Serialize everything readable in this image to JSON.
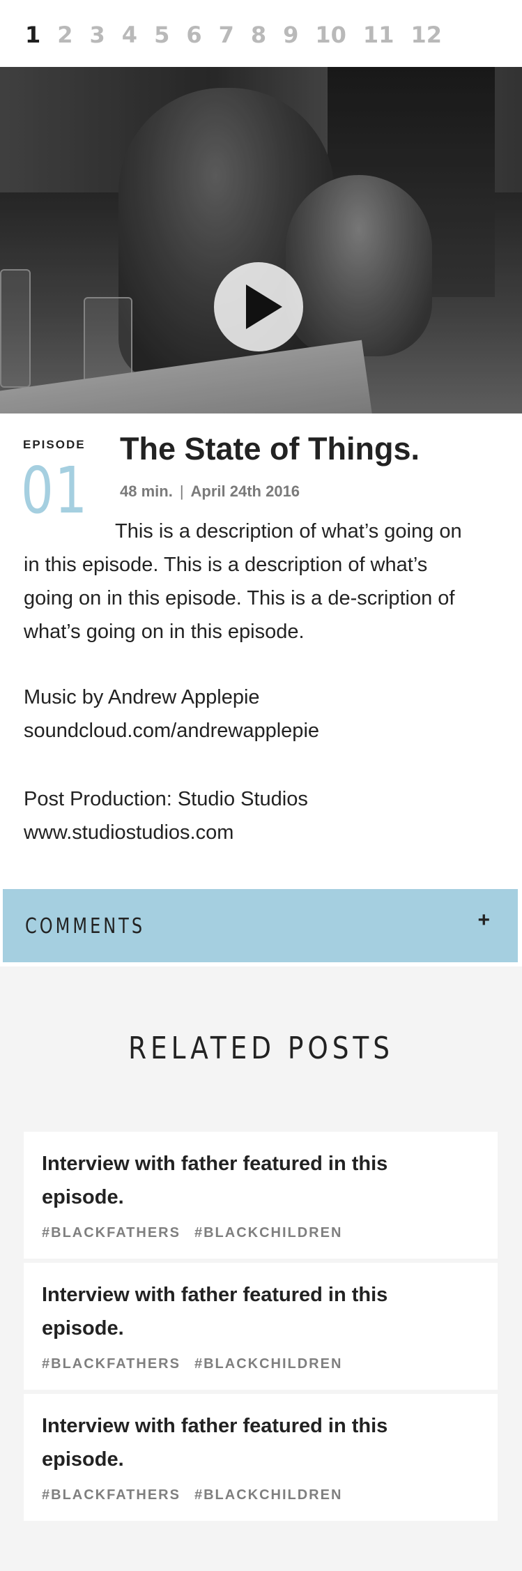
{
  "pagination": {
    "pages": [
      "1",
      "2",
      "3",
      "4",
      "5",
      "6",
      "7",
      "8",
      "9",
      "10",
      "11",
      "12"
    ],
    "active": "1"
  },
  "hero": {
    "play_icon": "play-icon"
  },
  "episode": {
    "label": "EPISODE",
    "number": "01",
    "title": "The State of Things.",
    "duration": "48 min.",
    "separator": "|",
    "date": "April 24th 2016",
    "description": "This is a description of what’s going on in this episode. This is a description of what’s going on in this episode. This is a de-scription of what’s going on in this episode.",
    "music_credit": "Music by Andrew Applepie",
    "music_link": "soundcloud.com/andrewapplepie",
    "post_credit": "Post Production: Studio Studios",
    "post_link": "www.studiostudios.com"
  },
  "comments": {
    "label": "COMMENTS",
    "toggle": "+"
  },
  "related": {
    "heading": "RELATED POSTS",
    "posts": [
      {
        "title": "Interview with father featured in this episode.",
        "tags": [
          "#BLACKFATHERS",
          "#BLACKCHILDREN"
        ]
      },
      {
        "title": "Interview with father featured in this episode.",
        "tags": [
          "#BLACKFATHERS",
          "#BLACKCHILDREN"
        ]
      },
      {
        "title": "Interview with father featured in this episode.",
        "tags": [
          "#BLACKFATHERS",
          "#BLACKCHILDREN"
        ]
      }
    ]
  },
  "colors": {
    "accent": "#a5cfe0",
    "text": "#222222",
    "muted": "#7a7a7a",
    "pager_inactive": "#b9b9b9",
    "related_bg": "#f4f4f4"
  }
}
